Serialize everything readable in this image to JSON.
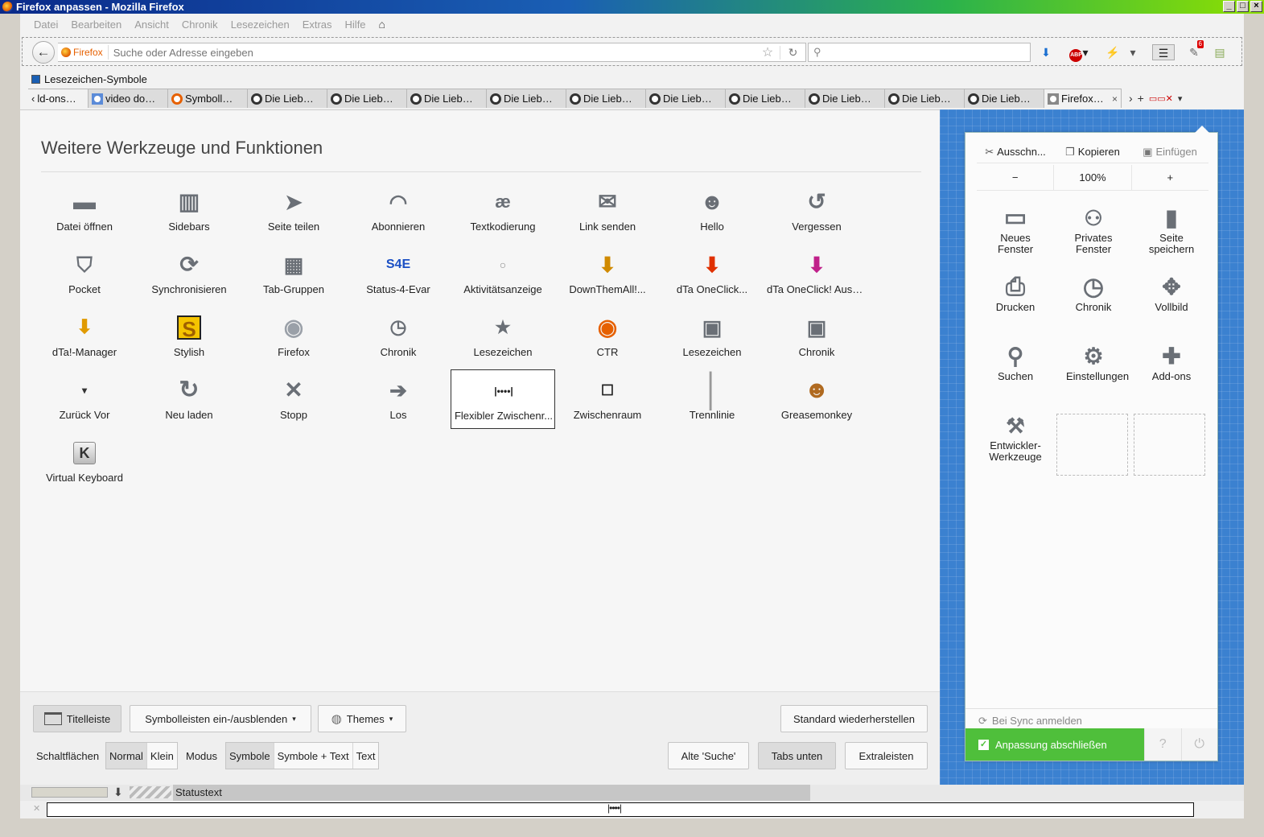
{
  "window": {
    "title": "Firefox anpassen - Mozilla Firefox"
  },
  "menu": [
    "Datei",
    "Bearbeiten",
    "Ansicht",
    "Chronik",
    "Lesezeichen",
    "Extras",
    "Hilfe"
  ],
  "navbar": {
    "identity_label": "Firefox",
    "url_placeholder": "Suche oder Adresse eingeben",
    "addon_badge": "6"
  },
  "bookmarks": {
    "item": "Lesezeichen-Symbole"
  },
  "tabs": [
    "ld-ons…",
    "video do…",
    "Symboll…",
    "Die Lieb…",
    "Die Lieb…",
    "Die Lieb…",
    "Die Lieb…",
    "Die Lieb…",
    "Die Lieb…",
    "Die Lieb…",
    "Die Lieb…",
    "Die Lieb…",
    "Die Lieb…",
    "Firefox…"
  ],
  "customize": {
    "heading": "Weitere Werkzeuge und Funktionen",
    "palette": [
      {
        "label": "Datei öffnen",
        "icon": "folder-icon"
      },
      {
        "label": "Sidebars",
        "icon": "sidebar-icon"
      },
      {
        "label": "Seite teilen",
        "icon": "share-icon"
      },
      {
        "label": "Abonnieren",
        "icon": "feed-icon"
      },
      {
        "label": "Textkodierung",
        "icon": "text-encoding-icon"
      },
      {
        "label": "Link senden",
        "icon": "mail-icon"
      },
      {
        "label": "Hello",
        "icon": "hello-icon"
      },
      {
        "label": "Vergessen",
        "icon": "forget-icon"
      },
      {
        "label": "Pocket",
        "icon": "pocket-icon"
      },
      {
        "label": "Synchronisieren",
        "icon": "sync-icon"
      },
      {
        "label": "Tab-Gruppen",
        "icon": "tab-groups-icon"
      },
      {
        "label": "Status-4-Evar",
        "icon": "status4evar-icon"
      },
      {
        "label": "Aktivitätsanzeige",
        "icon": "activity-icon"
      },
      {
        "label": "DownThemAll!...",
        "icon": "downthemall-icon"
      },
      {
        "label": "dTa OneClick...",
        "icon": "dta-oneclick-icon"
      },
      {
        "label": "dTa OneClick! Ausw...",
        "icon": "dta-oneclick-select-icon"
      },
      {
        "label": "dTa!-Manager",
        "icon": "dta-manager-icon"
      },
      {
        "label": "Stylish",
        "icon": "stylish-icon"
      },
      {
        "label": "Firefox",
        "icon": "firefox-gray-icon"
      },
      {
        "label": "Chronik",
        "icon": "history-icon"
      },
      {
        "label": "Lesezeichen",
        "icon": "bookmark-star-icon"
      },
      {
        "label": "CTR",
        "icon": "firefox-icon"
      },
      {
        "label": "Lesezeichen",
        "icon": "bookmarks-library-icon"
      },
      {
        "label": "Chronik",
        "icon": "history-library-icon"
      },
      {
        "label": "Zurück Vor",
        "icon": "back-forward-icon"
      },
      {
        "label": "Neu laden",
        "icon": "reload-icon"
      },
      {
        "label": "Stopp",
        "icon": "stop-icon"
      },
      {
        "label": "Los",
        "icon": "go-arrow-icon"
      },
      {
        "label": "Flexibler Zwischenr...",
        "icon": "flexible-space-icon"
      },
      {
        "label": "Zwischenraum",
        "icon": "space-icon"
      },
      {
        "label": "Trennlinie",
        "icon": "separator-icon"
      },
      {
        "label": "Greasemonkey",
        "icon": "greasemonkey-icon"
      },
      {
        "label": "Virtual Keyboard",
        "icon": "keyboard-icon"
      }
    ]
  },
  "bottom": {
    "titlebar_btn": "Titelleiste",
    "toolbars_btn": "Symbolleisten ein-/ausblenden",
    "themes_btn": "Themes",
    "restore_btn": "Standard wiederherstellen",
    "buttons_label": "Schaltflächen",
    "size_options": [
      "Normal",
      "Klein"
    ],
    "mode_label": "Modus",
    "mode_options": [
      "Symbole",
      "Symbole + Text",
      "Text"
    ],
    "old_search_btn": "Alte 'Suche'",
    "tabs_below_btn": "Tabs unten",
    "extra_bars_btn": "Extraleisten"
  },
  "panel": {
    "cut": "Ausschn...",
    "copy": "Kopieren",
    "paste": "Einfügen",
    "zoom_out": "−",
    "zoom_level": "100%",
    "zoom_in": "+",
    "items": [
      {
        "label": "Neues Fenster",
        "icon": "new-window-icon"
      },
      {
        "label": "Privates Fenster",
        "icon": "private-mask-icon"
      },
      {
        "label": "Seite speichern",
        "icon": "save-page-icon"
      },
      {
        "label": "Drucken",
        "icon": "print-icon"
      },
      {
        "label": "Chronik",
        "icon": "history-clock-icon"
      },
      {
        "label": "Vollbild",
        "icon": "fullscreen-icon"
      },
      {
        "label": "Suchen",
        "icon": "search-icon"
      },
      {
        "label": "Einstellungen",
        "icon": "gear-icon"
      },
      {
        "label": "Add-ons",
        "icon": "puzzle-icon"
      },
      {
        "label": "Entwickler-Werkzeuge",
        "icon": "wrench-icon"
      }
    ],
    "sync": "Bei Sync anmelden",
    "finish": "Anpassung abschließen"
  },
  "statusbar": {
    "text": "Statustext"
  }
}
